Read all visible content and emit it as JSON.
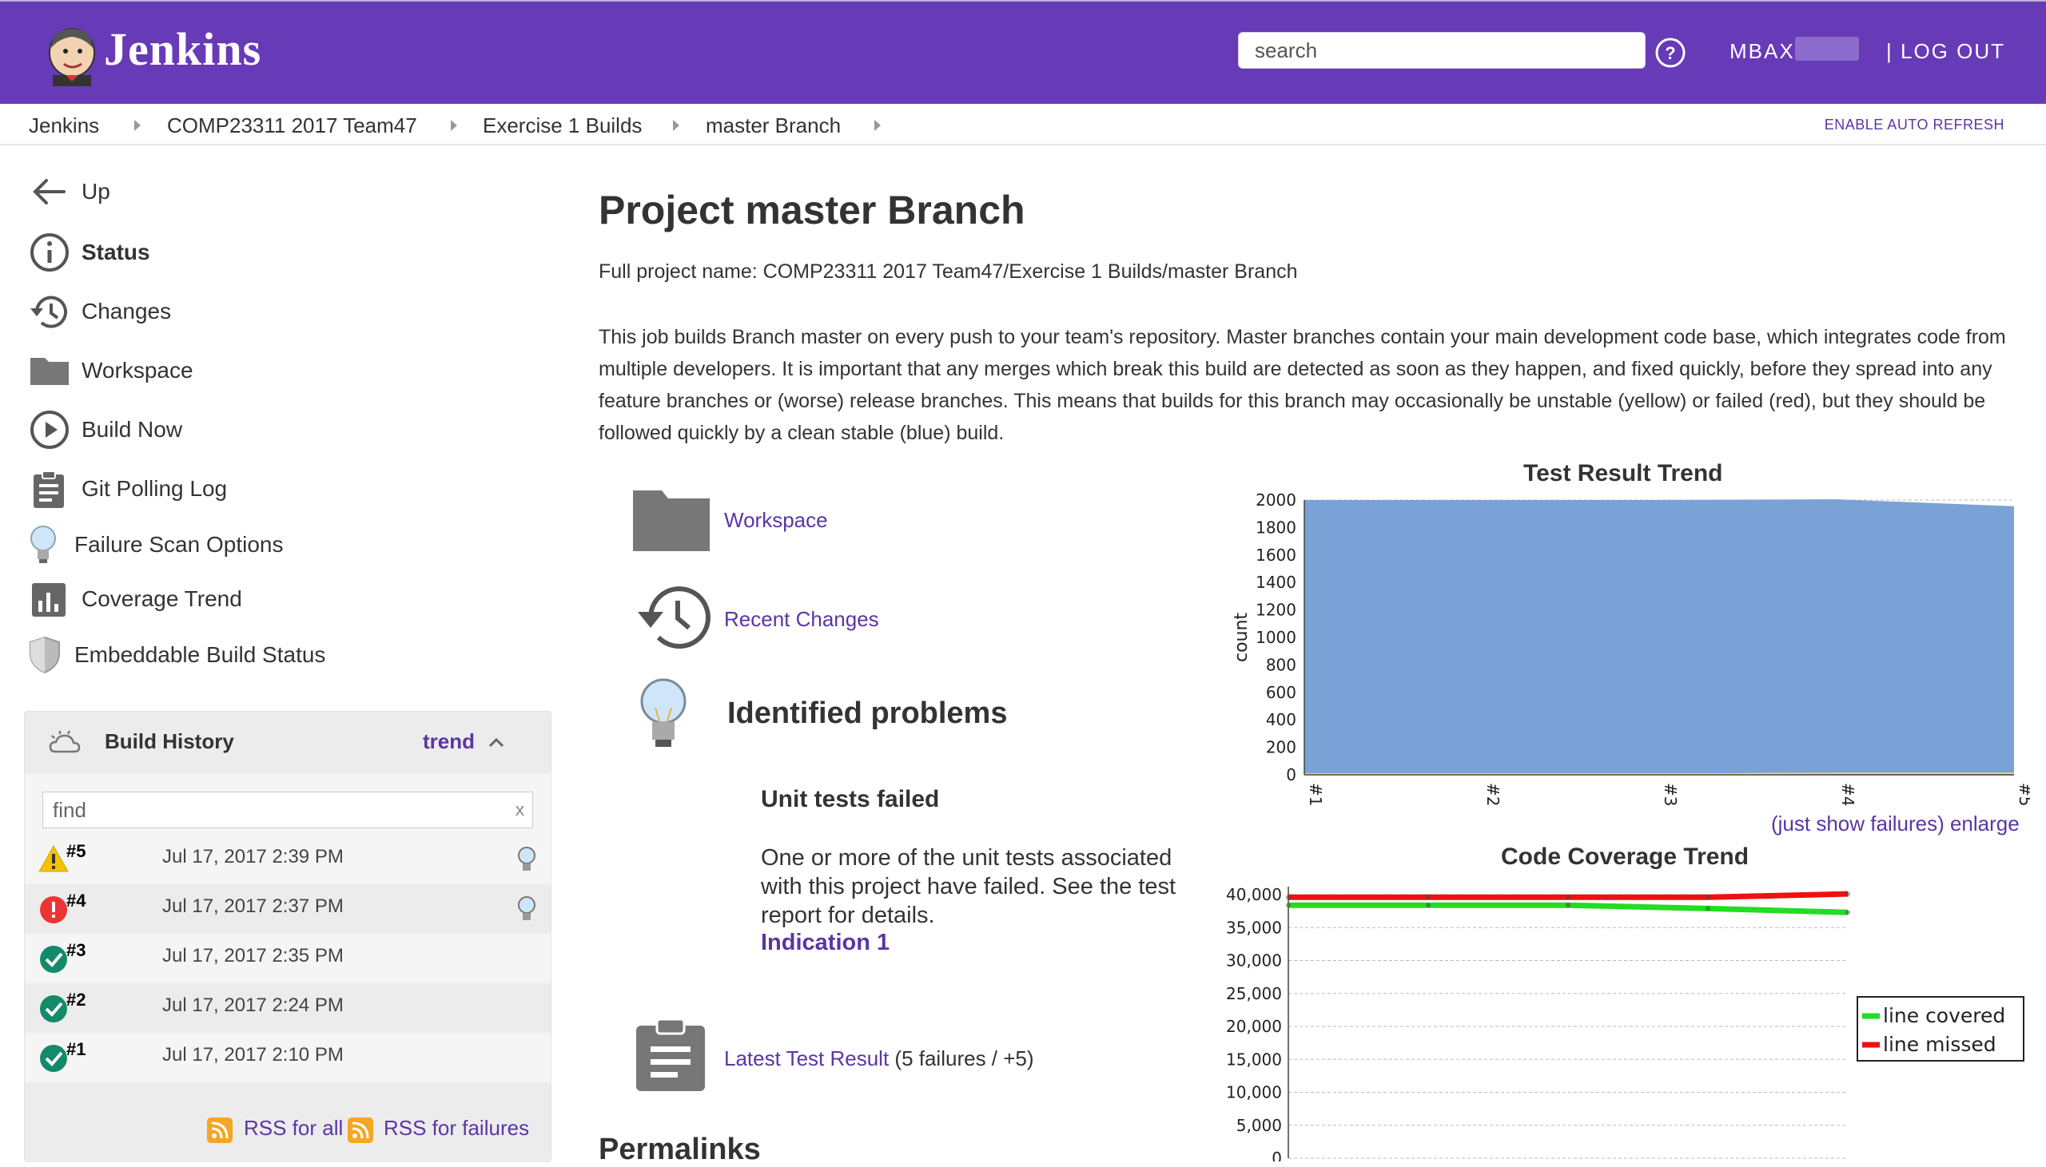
{
  "header": {
    "brand": "Jenkins",
    "search_placeholder": "search",
    "user": "MBAX",
    "logout": "| LOG OUT",
    "accent_color": "#673ab7"
  },
  "breadcrumb": {
    "items": [
      "Jenkins",
      "COMP23311 2017 Team47",
      "Exercise 1 Builds",
      "master Branch"
    ],
    "auto_refresh": "ENABLE AUTO REFRESH"
  },
  "sidebar": {
    "tasks": [
      {
        "label": "Up",
        "icon": "arrow-left-icon"
      },
      {
        "label": "Status",
        "icon": "info-icon"
      },
      {
        "label": "Changes",
        "icon": "history-icon"
      },
      {
        "label": "Workspace",
        "icon": "folder-icon"
      },
      {
        "label": "Build Now",
        "icon": "play-icon"
      },
      {
        "label": "Git Polling Log",
        "icon": "clipboard-icon"
      },
      {
        "label": "Failure Scan Options",
        "icon": "lightbulb-icon"
      },
      {
        "label": "Coverage Trend",
        "icon": "bar-chart-icon"
      },
      {
        "label": "Embeddable Build Status",
        "icon": "shield-icon"
      }
    ]
  },
  "build_history": {
    "title": "Build History",
    "trend": "trend",
    "find_placeholder": "find",
    "find_clear": "x",
    "builds": [
      {
        "number": "#5",
        "date": "Jul 17, 2017 2:39 PM",
        "status": "unstable",
        "has_bulb": true
      },
      {
        "number": "#4",
        "date": "Jul 17, 2017 2:37 PM",
        "status": "failed",
        "has_bulb": true
      },
      {
        "number": "#3",
        "date": "Jul 17, 2017 2:35 PM",
        "status": "success",
        "has_bulb": false
      },
      {
        "number": "#2",
        "date": "Jul 17, 2017 2:24 PM",
        "status": "success",
        "has_bulb": false
      },
      {
        "number": "#1",
        "date": "Jul 17, 2017 2:10 PM",
        "status": "success",
        "has_bulb": false
      }
    ],
    "rss_all": "RSS for all",
    "rss_failures": "RSS for failures"
  },
  "main": {
    "title": "Project master Branch",
    "full_name": "Full project name: COMP23311 2017 Team47/Exercise 1 Builds/master Branch",
    "description": "This job builds Branch master on every push to your team's repository.  Master branches contain your main development code base, which integrates code from multiple developers.  It is important that any merges which break this build are detected as soon as they happen, and fixed quickly, before they spread into any feature branches or (worse) release branches.  This means that builds for this branch may occasionally be unstable (yellow) or failed (red), but they should be followed quickly by a clean stable (blue) build.",
    "workspace_link": "Workspace",
    "recent_changes_link": "Recent Changes",
    "identified_problems": "Identified problems",
    "unit_tests_title": "Unit tests failed",
    "unit_tests_text": "One or more of the unit tests associated with this project have failed.  See the test report for details.",
    "indication": "Indication 1",
    "latest_test_link": "Latest Test Result",
    "latest_test_suffix": " (5 failures / +5)",
    "permalinks": "Permalinks",
    "trend_links": "(just show failures) enlarge"
  },
  "chart_data": [
    {
      "type": "area",
      "title": "Test Result Trend",
      "ylabel": "count",
      "xlabel": "",
      "categories": [
        "#1",
        "#2",
        "#3",
        "#4",
        "#5"
      ],
      "ylim": [
        0,
        2000
      ],
      "yticks": [
        0,
        200,
        400,
        600,
        800,
        1000,
        1200,
        1400,
        1600,
        1800,
        2000
      ],
      "series": [
        {
          "name": "",
          "color": "#7ba2d6",
          "values": [
            1990,
            1990,
            1990,
            1990,
            1940
          ]
        },
        {
          "name": "",
          "color": "#e8e25a",
          "values": [
            10,
            10,
            10,
            10,
            10
          ]
        },
        {
          "name": "",
          "color": "#d24a1f",
          "values": [
            0,
            0,
            0,
            5,
            5
          ]
        }
      ],
      "grid": true
    },
    {
      "type": "line",
      "title": "Code Coverage Trend",
      "ylim": [
        0,
        40000
      ],
      "yticks": [
        "0",
        "5,000",
        "10,000",
        "15,000",
        "20,000",
        "25,000",
        "30,000",
        "35,000",
        "40,000"
      ],
      "x": [
        1,
        2,
        3,
        4,
        5
      ],
      "series": [
        {
          "name": "line covered",
          "color": "#22dd22",
          "values": [
            38400,
            38400,
            38400,
            37900,
            37300
          ]
        },
        {
          "name": "line missed",
          "color": "#ee1111",
          "values": [
            39600,
            39600,
            39600,
            39600,
            40100
          ]
        }
      ],
      "legend": "right",
      "grid": true
    }
  ]
}
